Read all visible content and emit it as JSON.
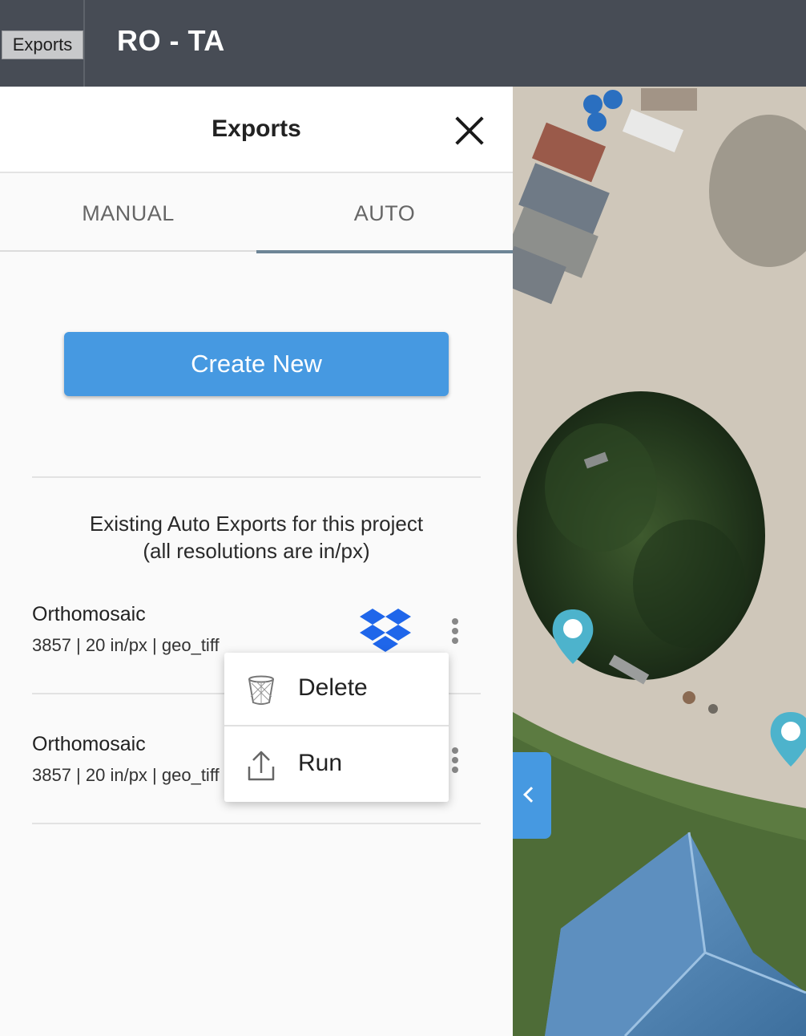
{
  "topbar": {
    "exports_tag": "Exports",
    "project_title": "RO - TA"
  },
  "panel": {
    "title": "Exports",
    "tabs": [
      {
        "label": "MANUAL",
        "active": false
      },
      {
        "label": "AUTO",
        "active": true
      }
    ],
    "create_button": "Create New",
    "info_line1": "Existing Auto Exports for this project",
    "info_line2": "(all resolutions are in/px)",
    "exports": [
      {
        "title": "Orthomosaic",
        "details": "3857 | 20 in/px | geo_tiff",
        "destination_icon": "dropbox-icon"
      },
      {
        "title": "Orthomosaic",
        "details": "3857 | 20 in/px | geo_tiff"
      }
    ]
  },
  "menu": {
    "items": [
      {
        "label": "Delete",
        "icon": "trash-icon"
      },
      {
        "label": "Run",
        "icon": "upload-icon"
      }
    ]
  },
  "colors": {
    "topbar": "#474c55",
    "accent": "#4699e1",
    "tab_indicator": "#6d8596",
    "dropbox": "#1f66ea",
    "map_pin": "#4db3cc"
  }
}
